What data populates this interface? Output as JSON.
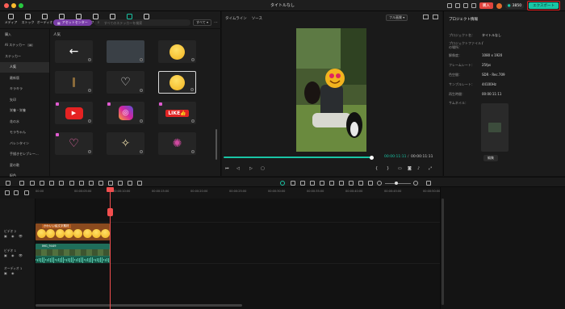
{
  "window": {
    "title": "タイトルなし"
  },
  "topbar": {
    "buy_label": "購入",
    "credits": "3850",
    "export_label": "エクスポート"
  },
  "media_tabs": [
    {
      "label": "メディア",
      "icon": "media-icon"
    },
    {
      "label": "ストック",
      "icon": "stock-icon"
    },
    {
      "label": "オーディオ",
      "icon": "audio-icon"
    },
    {
      "label": "タイトル",
      "icon": "title-icon"
    },
    {
      "label": "トランジション",
      "icon": "transition-icon"
    },
    {
      "label": "エフェクト",
      "icon": "effect-icon"
    },
    {
      "label": "フィルター",
      "icon": "filter-icon"
    },
    {
      "label": "ステッカー",
      "icon": "sticker-icon",
      "active": true
    },
    {
      "label": "テンプレート",
      "icon": "template-icon"
    }
  ],
  "sidebar": {
    "items": [
      {
        "label": "購入"
      },
      {
        "label": "AI ステッカー",
        "tag": "AI"
      },
      {
        "label": "ステッカー"
      },
      {
        "label": "人気"
      },
      {
        "label": "最新版"
      },
      {
        "label": "キラキラ"
      },
      {
        "label": "矢印"
      },
      {
        "label": "栄養・栄養"
      },
      {
        "label": "花の水"
      },
      {
        "label": "モラちゃん"
      },
      {
        "label": "バレンタイン"
      },
      {
        "label": "手描きセレブレー..."
      },
      {
        "label": "夏の歌"
      },
      {
        "label": "配色"
      }
    ]
  },
  "search": {
    "asset_center_label": "アセットセンター",
    "placeholder": "すべてのステッカーを検索",
    "filter_label": "すべて"
  },
  "section_label": "人気",
  "stickers": [
    {
      "name": "arrow-sticker",
      "glyph": "←"
    },
    {
      "name": "smoke-sticker",
      "glyph": ""
    },
    {
      "name": "laughing-emoji-sticker",
      "glyph": "😂"
    },
    {
      "name": "grass-sticker",
      "glyph": ""
    },
    {
      "name": "heart-outline-sticker",
      "glyph": "♡"
    },
    {
      "name": "heart-eyes-emoji-sticker",
      "glyph": "😍"
    },
    {
      "name": "youtube-sticker",
      "glyph": "▶"
    },
    {
      "name": "instagram-sticker",
      "glyph": "◎"
    },
    {
      "name": "like-sticker",
      "glyph": "LIKE👍"
    },
    {
      "name": "glow-heart-sticker",
      "glyph": "♡"
    },
    {
      "name": "sparkle-sticker",
      "glyph": "✧"
    },
    {
      "name": "firework-sticker",
      "glyph": "✺"
    }
  ],
  "viewer": {
    "tab_timeline": "タイムライン",
    "tab_source": "ソース",
    "quality": "フル画質",
    "current_time": "00:00:11:11",
    "separator": "/",
    "total_time": "00:00:11:11",
    "progress": 0.99
  },
  "info": {
    "title": "プロジェクト情報",
    "rows": [
      {
        "k": "プロジェクト名：",
        "v": "タイトルなし"
      },
      {
        "k": "プロジェクトファイルの場所：",
        "v": "/"
      },
      {
        "k": "解像度：",
        "v": "1080 x 1920"
      },
      {
        "k": "フレームレート：",
        "v": "25fps"
      },
      {
        "k": "色空間：",
        "v": "SDR - Rec.709"
      },
      {
        "k": "サンプルレート：",
        "v": "44100Hz"
      },
      {
        "k": "再生時間：",
        "v": "00:00:11:11"
      },
      {
        "k": "サムネイル：",
        "v": ""
      }
    ],
    "edit_label": "編集"
  },
  "ruler_ticks": [
    "00:00",
    "00:00:05:00",
    "00:00:10:00",
    "00:00:15:00",
    "00:00:20:00",
    "00:00:25:00",
    "00:00:30:00",
    "00:00:35:00",
    "00:00:40:00",
    "00:00:45:00",
    "00:00:50:00"
  ],
  "tracks": [
    {
      "label": "ビデオ 2",
      "icons": "▣ ◉ 👁"
    },
    {
      "label": "ビデオ 1",
      "icons": "▣ ◉ 👁"
    },
    {
      "label": "オーディオ 1",
      "icons": "▣ ◉"
    }
  ],
  "clips": {
    "sticker_label": "かわいい絵文字素材",
    "video_label": "IMG_9449"
  }
}
